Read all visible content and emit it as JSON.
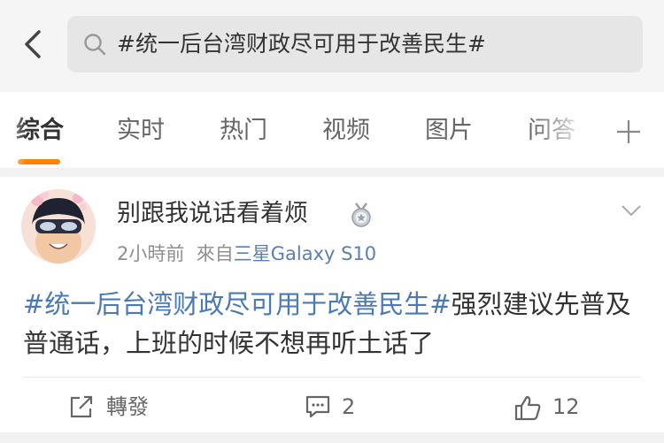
{
  "header": {
    "back_icon": "chevron-left-icon",
    "search_icon": "search-icon",
    "search_text": "#统一后台湾财政尽可用于改善民生#"
  },
  "tabs": [
    {
      "label": "综合",
      "active": true
    },
    {
      "label": "实时",
      "active": false
    },
    {
      "label": "热门",
      "active": false
    },
    {
      "label": "视频",
      "active": false
    },
    {
      "label": "图片",
      "active": false
    },
    {
      "label": "问答",
      "active": false
    }
  ],
  "tab_add_icon": "plus-icon",
  "accent_color": "#ff8200",
  "link_color": "#4a79b8",
  "post": {
    "username": "别跟我说话看着烦",
    "badge_icon": "medal-icon",
    "time": "2小時前",
    "source_prefix": "來自",
    "source": "三星Galaxy S10",
    "topic": "#统一后台湾财政尽可用于改善民生#",
    "text": "强烈建议先普及普通话，上班的时候不想再听土话了",
    "actions": {
      "repost_label": "轉發",
      "comment_count": "2",
      "like_count": "12"
    }
  }
}
